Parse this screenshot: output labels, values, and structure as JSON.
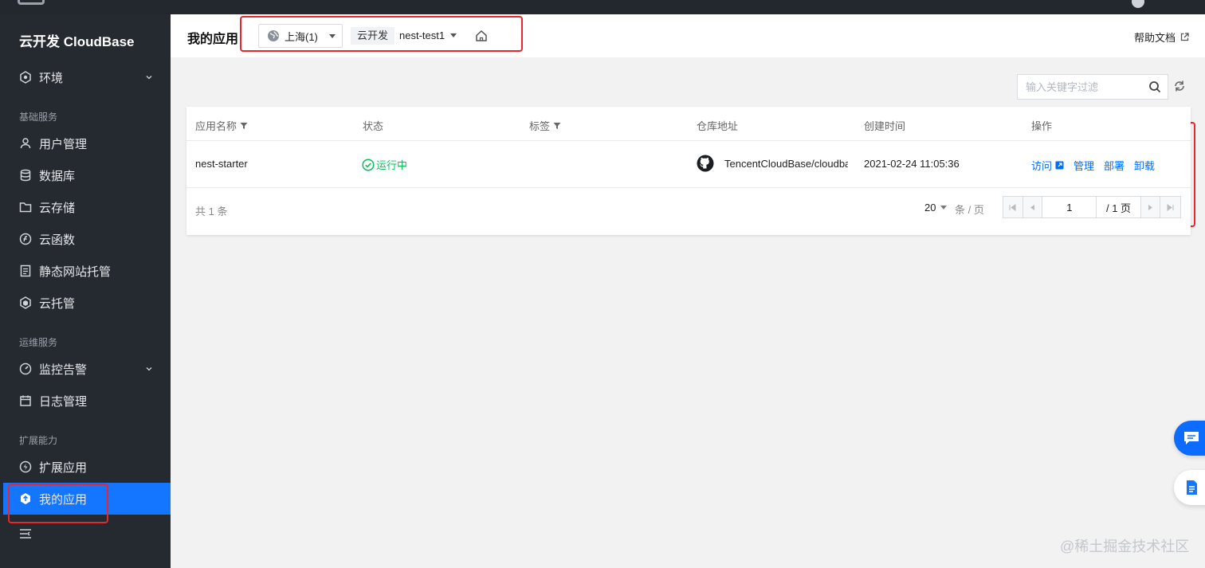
{
  "colors": {
    "accent": "#006eff",
    "active_nav": "#1476ff",
    "sidebar_bg": "#252a31",
    "success": "#0abf5b",
    "annotation_red": "#e8262b"
  },
  "sidebar": {
    "brand": "云开发 CloudBase",
    "env_item": {
      "label": "环境",
      "icon": "hexagon-icon"
    },
    "groups": [
      {
        "label": "基础服务",
        "items": [
          {
            "label": "用户管理",
            "icon": "user-icon"
          },
          {
            "label": "数据库",
            "icon": "database-icon"
          },
          {
            "label": "云存储",
            "icon": "folder-icon"
          },
          {
            "label": "云函数",
            "icon": "function-icon"
          },
          {
            "label": "静态网站托管",
            "icon": "document-icon"
          },
          {
            "label": "云托管",
            "icon": "cube-icon"
          }
        ]
      },
      {
        "label": "运维服务",
        "items": [
          {
            "label": "监控告警",
            "icon": "monitor-icon"
          },
          {
            "label": "日志管理",
            "icon": "calendar-log-icon"
          }
        ]
      },
      {
        "label": "扩展能力",
        "items": [
          {
            "label": "扩展应用",
            "icon": "lightning-icon"
          },
          {
            "label": "我的应用",
            "icon": "my-app-icon",
            "active": true
          }
        ]
      }
    ]
  },
  "header": {
    "title": "我的应用",
    "region": "上海(1)",
    "env_tag": "云开发",
    "env_name": "nest-test1",
    "help_link": "帮助文档"
  },
  "toolbar": {
    "search_placeholder": "输入关键字过滤"
  },
  "table": {
    "columns": [
      "应用名称",
      "状态",
      "标签",
      "仓库地址",
      "创建时间",
      "操作"
    ],
    "rows": [
      {
        "name": "nest-starter",
        "status": "运行中",
        "tags": "",
        "repo": "TencentCloudBase/cloudbase-templates",
        "created": "2021-02-24 11:05:36",
        "actions": [
          "访问",
          "管理",
          "部署",
          "卸载"
        ]
      }
    ],
    "total": "共 1 条",
    "page_size": "20",
    "page_unit": "条 / 页",
    "current_page": "1",
    "total_pages": "/ 1 页"
  },
  "watermark": "@稀土掘金技术社区"
}
